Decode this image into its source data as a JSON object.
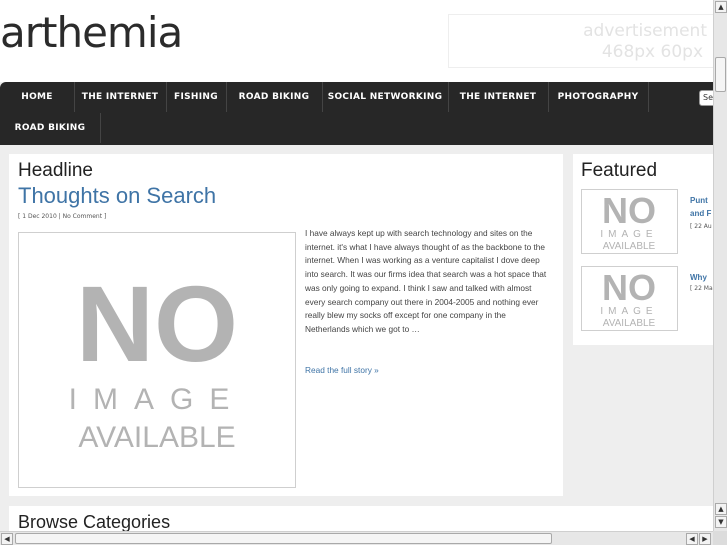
{
  "header": {
    "logo": "arthemia",
    "ad_line1": "advertisement",
    "ad_line2": "468px 60px"
  },
  "nav": {
    "items": [
      "HOME",
      "THE INTERNET",
      "FISHING",
      "ROAD BIKING",
      "SOCIAL NETWORKING",
      "THE INTERNET",
      "PHOTOGRAPHY",
      "ROAD BIKING"
    ],
    "search_value": "Se"
  },
  "headline": {
    "section_title": "Headline",
    "post_title": "Thoughts on Search",
    "meta": "[ 1 Dec 2010 | No Comment ]",
    "excerpt": "I have always kept up with search technology and sites on the internet. it's what I have always thought of as the backbone to the internet. When I was working as a venture capitalist I dove deep into search. It was our firms idea that search was a hot space that was only going to expand. I think I saw and talked with almost every search company out there in 2004-2005 and nothing ever really blew my socks off except for one company in the Netherlands which we got to …",
    "read_more": "Read the full story »"
  },
  "no_image": {
    "big": "NO",
    "mid": "IMAGE",
    "bottom": "AVAILABLE"
  },
  "featured": {
    "title": "Featured",
    "items": [
      {
        "line1": "Punt",
        "line2": "and F",
        "date": "[ 22 Au"
      },
      {
        "line1": "Why",
        "line2": "",
        "date": "[ 22 Ma"
      }
    ]
  },
  "browse": {
    "title": "Browse Categories"
  },
  "colors": {
    "link": "#3f74a6",
    "nav_bg": "#272727",
    "page_bg": "#eeeeee"
  },
  "icons": {
    "scroll_up": "scroll-up-arrow-icon",
    "scroll_down": "scroll-down-arrow-icon",
    "scroll_left": "scroll-left-arrow-icon",
    "scroll_right": "scroll-right-arrow-icon"
  }
}
